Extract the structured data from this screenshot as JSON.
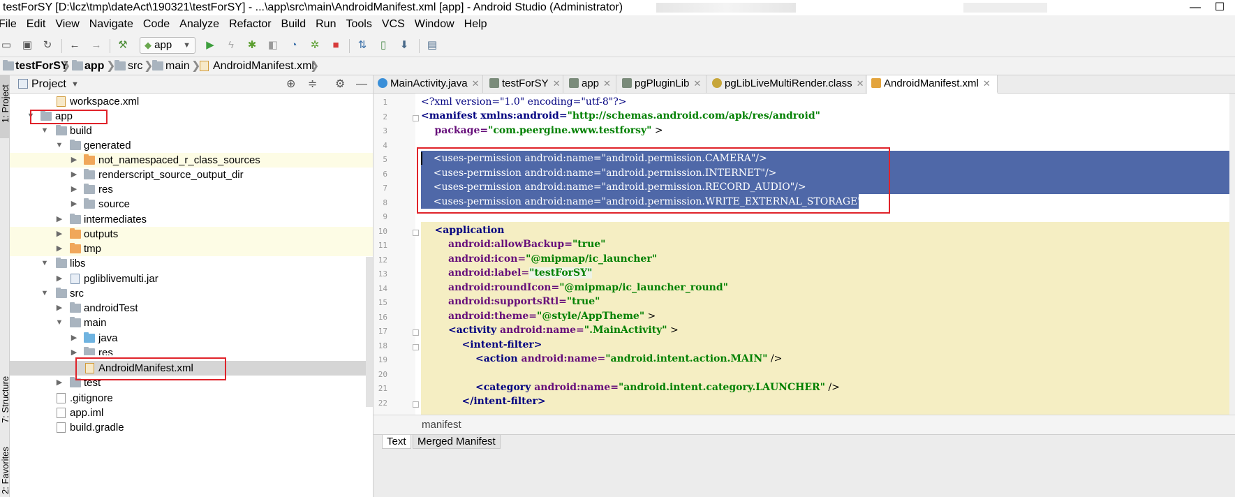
{
  "window": {
    "title": "testForSY [D:\\lcz\\tmp\\dateAct\\190321\\testForSY] - ...\\app\\src\\main\\AndroidManifest.xml [app] - Android Studio (Administrator)",
    "minimize": "—",
    "maximize": "☐"
  },
  "menu": [
    "File",
    "Edit",
    "View",
    "Navigate",
    "Code",
    "Analyze",
    "Refactor",
    "Build",
    "Run",
    "Tools",
    "VCS",
    "Window",
    "Help"
  ],
  "toolbar": {
    "run_config": "app",
    "icons": [
      "open-icon",
      "save-icon",
      "sync-icon",
      "back-icon",
      "forward-icon",
      "build-icon",
      "run-icon",
      "apply-changes-icon",
      "debug-icon",
      "attach-debugger-icon",
      "profile-icon",
      "run-test-icon",
      "stop-icon",
      "sync-gradle-icon",
      "avd-manager-icon",
      "sdk-manager-icon",
      "project-structure-icon"
    ]
  },
  "breadcrumbs": [
    "testForSY",
    "app",
    "src",
    "main",
    "AndroidManifest.xml"
  ],
  "side_tools": {
    "project": "1: Project",
    "structure": "7: Structure",
    "favorites": "2: Favorites"
  },
  "project_panel": {
    "view_label": "Project",
    "tree": [
      {
        "label": "workspace.xml",
        "type": "file-xml"
      },
      {
        "label": "app",
        "type": "module"
      },
      {
        "label": "build",
        "type": "folder"
      },
      {
        "label": "generated",
        "type": "folder"
      },
      {
        "label": "not_namespaced_r_class_sources",
        "type": "folder-orange"
      },
      {
        "label": "renderscript_source_output_dir",
        "type": "folder"
      },
      {
        "label": "res",
        "type": "folder"
      },
      {
        "label": "source",
        "type": "folder"
      },
      {
        "label": "intermediates",
        "type": "folder"
      },
      {
        "label": "outputs",
        "type": "folder-orange"
      },
      {
        "label": "tmp",
        "type": "folder-orange"
      },
      {
        "label": "libs",
        "type": "folder"
      },
      {
        "label": "pgliblivemulti.jar",
        "type": "file-jar"
      },
      {
        "label": "src",
        "type": "folder"
      },
      {
        "label": "androidTest",
        "type": "folder"
      },
      {
        "label": "main",
        "type": "folder"
      },
      {
        "label": "java",
        "type": "folder-blue"
      },
      {
        "label": "res",
        "type": "folder"
      },
      {
        "label": "AndroidManifest.xml",
        "type": "file-xml"
      },
      {
        "label": "test",
        "type": "folder"
      },
      {
        "label": ".gitignore",
        "type": "file"
      },
      {
        "label": "app.iml",
        "type": "file"
      },
      {
        "label": "build.gradle",
        "type": "file"
      }
    ]
  },
  "tabs": [
    {
      "label": "MainActivity.java"
    },
    {
      "label": "testForSY"
    },
    {
      "label": "app"
    },
    {
      "label": "pgPluginLib"
    },
    {
      "label": "pgLibLiveMultiRender.class"
    },
    {
      "label": "AndroidManifest.xml"
    }
  ],
  "editor": {
    "line_numbers": [
      "1",
      "2",
      "3",
      "4",
      "5",
      "6",
      "7",
      "8",
      "9",
      "10",
      "11",
      "12",
      "13",
      "14",
      "15",
      "16",
      "17",
      "18",
      "19",
      "20",
      "21",
      "22"
    ],
    "lines": {
      "l1": "<?xml version=\"1.0\" encoding=\"utf-8\"?>",
      "l2a": "<manifest xmlns:android=",
      "l2b": "\"http://schemas.android.com/apk/res/android\"",
      "l3a": "    package=",
      "l3b": "\"com.peergine.www.testforsy\"",
      "l3c": " >",
      "l5": "    <uses-permission android:name=\"android.permission.CAMERA\"/>",
      "l6": "    <uses-permission android:name=\"android.permission.INTERNET\"/>",
      "l7": "    <uses-permission android:name=\"android.permission.RECORD_AUDIO\"/>",
      "l8": "    <uses-permission android:name=\"android.permission.WRITE_EXTERNAL_STORAGE\"/>",
      "l10a": "    <application",
      "l11a": "        android:allowBackup=",
      "l11b": "\"true\"",
      "l12a": "        android:icon=",
      "l12b": "\"@mipmap/ic_launcher\"",
      "l13a": "        android:label=",
      "l13b": "\"testForSY\"",
      "l14a": "        android:roundIcon=",
      "l14b": "\"@mipmap/ic_launcher_round\"",
      "l15a": "        android:supportsRtl=",
      "l15b": "\"true\"",
      "l16a": "        android:theme=",
      "l16b": "\"@style/AppTheme\"",
      "l16c": " >",
      "l17a": "        <activity ",
      "l17b": "android:name=",
      "l17c": "\".MainActivity\"",
      "l17d": " >",
      "l18a": "            <intent-filter>",
      "l19a": "                <action ",
      "l19b": "android:name=",
      "l19c": "\"android.intent.action.MAIN\"",
      "l19d": " />",
      "l21a": "                <category ",
      "l21b": "android:name=",
      "l21c": "\"android.intent.category.LAUNCHER\"",
      "l21d": " />",
      "l22a": "            </intent-filter>"
    },
    "bottom_breadcrumb": "manifest",
    "bottom_tabs": [
      "Text",
      "Merged Manifest"
    ]
  }
}
